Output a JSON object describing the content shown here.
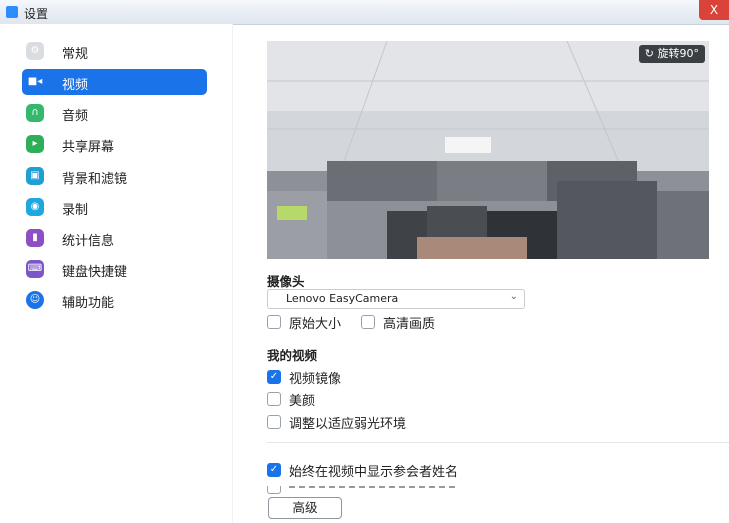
{
  "window": {
    "title": "设置",
    "close_label": "X"
  },
  "sidebar": {
    "items": [
      {
        "label": "常规",
        "icon": "gear-icon",
        "color": "#c8ccd2"
      },
      {
        "label": "视频",
        "icon": "video-camera-icon",
        "color": "#1a73e8"
      },
      {
        "label": "音频",
        "icon": "headphones-icon",
        "color": "#35b86c"
      },
      {
        "label": "共享屏幕",
        "icon": "share-screen-icon",
        "color": "#2fae59"
      },
      {
        "label": "背景和滤镜",
        "icon": "background-icon",
        "color": "#1f9fd6"
      },
      {
        "label": "录制",
        "icon": "record-icon",
        "color": "#1fa8e0"
      },
      {
        "label": "统计信息",
        "icon": "statistics-icon",
        "color": "#8e4ec6"
      },
      {
        "label": "键盘快捷键",
        "icon": "keyboard-icon",
        "color": "#7c56c7"
      },
      {
        "label": "辅助功能",
        "icon": "accessibility-icon",
        "color": "#1a73e8"
      }
    ],
    "active_index": 1
  },
  "preview": {
    "rotate_label": "旋转90°"
  },
  "camera": {
    "section_label": "摄像头",
    "selected": "Lenovo EasyCamera",
    "original_size_label": "原始大小",
    "original_size_checked": false,
    "hd_label": "高清画质",
    "hd_checked": false
  },
  "my_video": {
    "section_label": "我的视频",
    "mirror_label": "视频镜像",
    "mirror_checked": true,
    "beauty_label": "美颜",
    "beauty_checked": false,
    "low_light_label": "调整以适应弱光环境",
    "low_light_checked": false
  },
  "names": {
    "always_show_names_label": "始终在视频中显示参会者姓名",
    "always_show_names_checked": true
  },
  "advanced_button": "高级"
}
